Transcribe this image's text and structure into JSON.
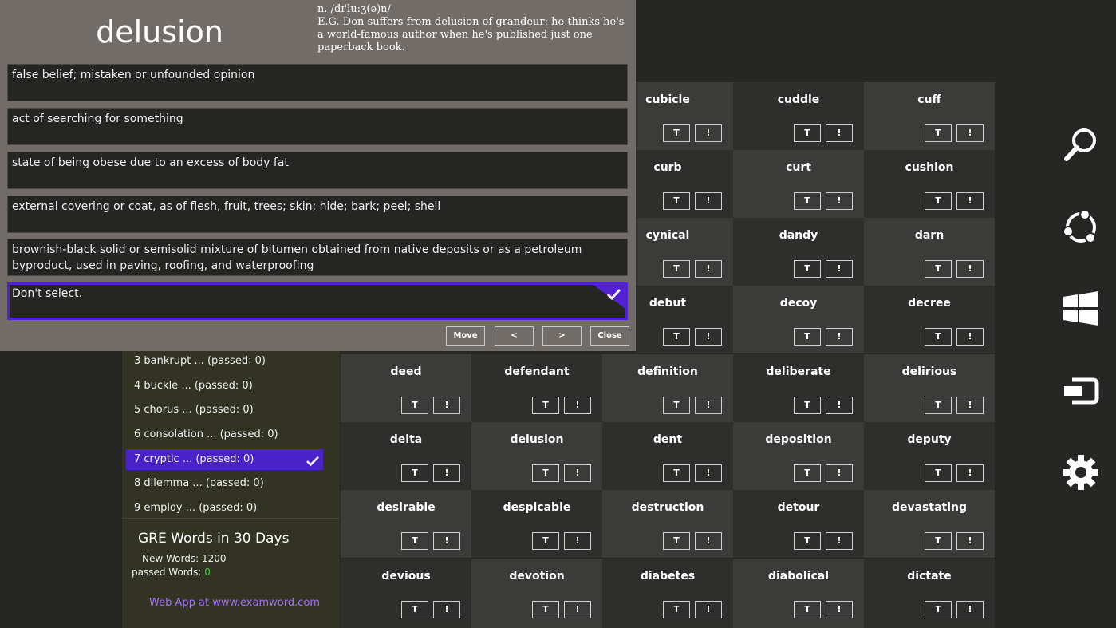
{
  "definition": {
    "headword": "delusion",
    "pronunciation": "n. /dɪ'lu:ʒ(ə)n/",
    "example": "E.G. Don suffers from delusion of grandeur: he thinks he's a world-famous author when he's published just one paperback book.",
    "options": [
      "false belief; mistaken or unfounded opinion",
      "act of searching for something",
      "state of being obese due to an excess of body fat",
      "external covering or coat, as of flesh, fruit, trees; skin; hide; bark; peel; shell",
      "brownish-black solid or semisolid mixture of bitumen obtained from native deposits or as a petroleum byproduct, used in paving, roofing, and waterproofing",
      "Don't select."
    ],
    "selected_option": 5,
    "buttons": {
      "move": "Move",
      "prev": "<",
      "next": ">",
      "close": "Close"
    }
  },
  "lessons": {
    "items": [
      "3 bankrupt ... (passed: 0)",
      "4 buckle ... (passed: 0)",
      "5 chorus ... (passed: 0)",
      "6 consolation ... (passed: 0)",
      "7 cryptic ... (passed: 0)",
      "8 dilemma ... (passed: 0)",
      "9 employ ... (passed: 0)"
    ],
    "selected_index": 4
  },
  "app": {
    "title": "GRE Words in 30 Days",
    "new_words_label": "New Words: 1200",
    "passed_words_label": "passed Words: ",
    "passed_words_count": "0",
    "web_link": "Web App at www.examword.com"
  },
  "word_grid": {
    "t_label": "T",
    "x_label": "!",
    "rows": [
      [
        "",
        "",
        "cubicle",
        "cuddle",
        "cuff"
      ],
      [
        "",
        "",
        "curb",
        "curt",
        "cushion"
      ],
      [
        "",
        "",
        "cynical",
        "dandy",
        "darn"
      ],
      [
        "",
        "",
        "debut",
        "decoy",
        "decree"
      ],
      [
        "deed",
        "defendant",
        "definition",
        "deliberate",
        "delirious"
      ],
      [
        "delta",
        "delusion",
        "dent",
        "deposition",
        "deputy"
      ],
      [
        "desirable",
        "despicable",
        "destruction",
        "detour",
        "devastating"
      ],
      [
        "devious",
        "devotion",
        "diabetes",
        "diabolical",
        "dictate"
      ]
    ]
  },
  "colors": {
    "tile_light": "#3b3b39",
    "tile_dark": "#2e2e2c",
    "accent": "#4a23c8",
    "passed_green": "#3ad13a",
    "link_purple": "#a070f0"
  },
  "charms": [
    "search-icon",
    "share-icon",
    "start-icon",
    "devices-icon",
    "settings-icon"
  ]
}
